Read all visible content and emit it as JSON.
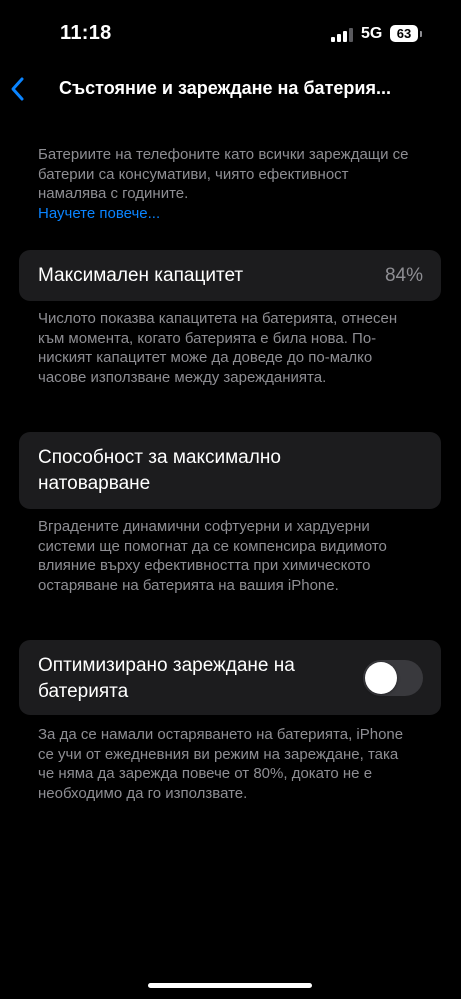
{
  "status_bar": {
    "time": "11:18",
    "network": "5G",
    "battery_level": "63",
    "signal_bars_active": 3,
    "signal_bars_total": 4,
    "icons": [
      "signal-icon",
      "battery-icon"
    ]
  },
  "nav": {
    "back_icon": "chevron-left-icon",
    "title": "Състояние и зареждане на батерия..."
  },
  "intro": {
    "text": "Батериите на телефоните като всички зареждащи се батерии са консумативи, чиято ефективност намалява с годините.",
    "link": "Научете повече..."
  },
  "max_capacity": {
    "label": "Максимален капацитет",
    "value": "84%",
    "note": "Числото показва капацитета на батерията, отнесен към момента, когато батерията е била нова. По-ниският капацитет може да доведе до по-малко часове използване между зарежданията."
  },
  "peak_performance": {
    "label": "Способност за максимално натоварване",
    "note": "Вградените динамични софтуерни и хардуерни системи ще помогнат да се компенсира видимото влияние върху ефективността при химическото остаряване на батерията на вашия iPhone."
  },
  "optimized_charging": {
    "label": "Оптимизирано зареждане на батерията",
    "enabled": false,
    "note": "За да се намали остаряването на батерията, iPhone се учи от ежедневния ви режим на зареждане, така че няма да зарежда повече от 80%, докато не е необходимо да го използвате."
  },
  "colors": {
    "background": "#000000",
    "card": "#1c1c1e",
    "secondary_text": "#8e8e93",
    "accent": "#0a84ff",
    "toggle_off": "#39393d"
  }
}
